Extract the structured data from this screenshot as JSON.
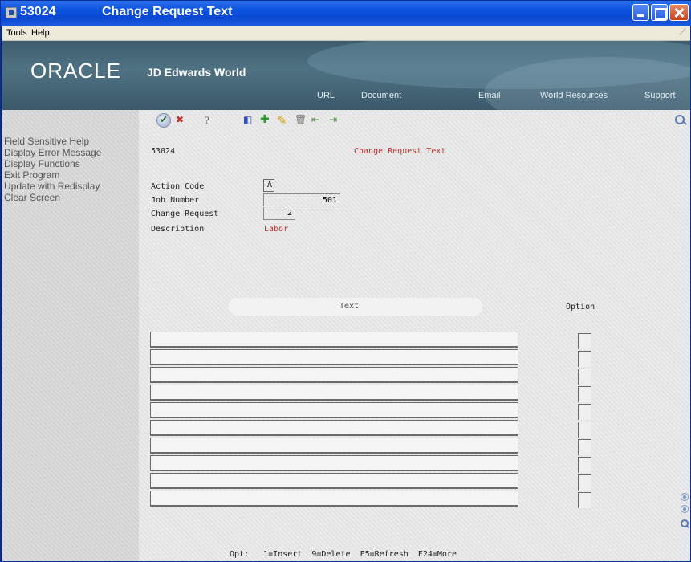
{
  "window": {
    "program_id": "53024",
    "title": "Change Request Text"
  },
  "menubar": {
    "items": [
      "Tools",
      "Help"
    ]
  },
  "banner": {
    "oracle": "ORACLE",
    "product": "JD Edwards World",
    "links": [
      "URL",
      "Document",
      "Email",
      "World Resources",
      "Support"
    ]
  },
  "sidebar": {
    "items": [
      "Field Sensitive Help",
      "Display Error Message",
      "Display Functions",
      "Exit Program",
      "Update with Redisplay",
      "Clear Screen"
    ]
  },
  "form": {
    "program_id": "53024",
    "heading": "Change Request Text",
    "action_code_label": "Action Code",
    "action_code_value": "A",
    "job_number_label": "Job Number",
    "job_number_value": "501",
    "change_request_label": "Change Request",
    "change_request_value": "2",
    "description_label": "Description",
    "description_value": "Labor",
    "text_column_header": "Text",
    "option_column_header": "Option",
    "footer": "Opt:   1=Insert  9=Delete  F5=Refresh  F24=More"
  },
  "colors": {
    "title_bar": "#0a52de",
    "heading_red": "#c03030",
    "banner": "#4f7283"
  },
  "icons": [
    "accept-icon",
    "cancel-icon",
    "help-icon",
    "inquire-icon",
    "add-icon",
    "change-icon",
    "delete-icon",
    "previous-icon",
    "next-icon",
    "search-icon"
  ]
}
